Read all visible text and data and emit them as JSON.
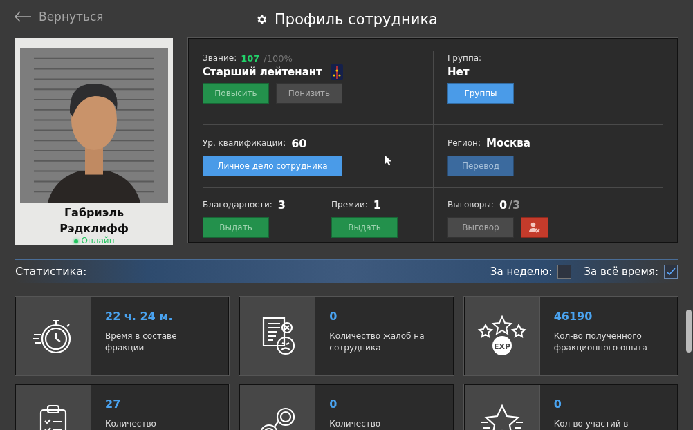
{
  "header": {
    "back": "Вернуться",
    "title": "Профиль сотрудника"
  },
  "profile": {
    "name": "Габриэль Рэдклифф",
    "status": "Онлайн",
    "online": true
  },
  "rank": {
    "label": "Звание:",
    "value": "107",
    "max": "/100%",
    "title": "Старший лейтенант",
    "buttons": [
      {
        "label": "Повысить",
        "kind": "green"
      },
      {
        "label": "Понизить",
        "kind": "gray"
      }
    ]
  },
  "group": {
    "label": "Группа:",
    "value": "Нет",
    "buttons": [
      {
        "label": "Группы",
        "kind": "blue"
      }
    ]
  },
  "qualification": {
    "label": "Ур. квалификации:",
    "value": "60",
    "buttons": [
      {
        "label": "Личное дело сотрудника",
        "kind": "blue"
      }
    ]
  },
  "region": {
    "label": "Регион:",
    "value": "Москва",
    "buttons": [
      {
        "label": "Перевод",
        "kind": "dim"
      }
    ]
  },
  "thanks": {
    "label": "Благодарности:",
    "value": "3",
    "buttons": [
      {
        "label": "Выдать",
        "kind": "green"
      }
    ]
  },
  "bonuses": {
    "label": "Премии:",
    "value": "1",
    "buttons": [
      {
        "label": "Выдать",
        "kind": "green"
      }
    ]
  },
  "reprimands": {
    "label": "Выговоры:",
    "value": "0",
    "max": "/3",
    "buttons": [
      {
        "label": "Выговор",
        "kind": "gray"
      },
      {
        "kind": "fire"
      }
    ]
  },
  "statistics": {
    "title": "Статистика:",
    "filters": [
      {
        "label": "За неделю:",
        "checked": false
      },
      {
        "label": "За всё время:",
        "checked": true
      }
    ],
    "cards": [
      {
        "kind": "stopwatch",
        "value": "22 ч. 24 м.",
        "label": "Время в составе фракции"
      },
      {
        "kind": "complaint",
        "value": "0",
        "label": "Количество жалоб на сотрудника"
      },
      {
        "kind": "exp",
        "icon_text": "EXP",
        "value": "46190",
        "label": "Кол-во полученного фракционного опыта"
      },
      {
        "kind": "clipboard",
        "value": "27",
        "label": "Количество"
      },
      {
        "kind": "handcuffs",
        "value": "0",
        "label": "Количество"
      },
      {
        "kind": "star",
        "value": "0",
        "label": "Кол-во участий в"
      }
    ]
  }
}
